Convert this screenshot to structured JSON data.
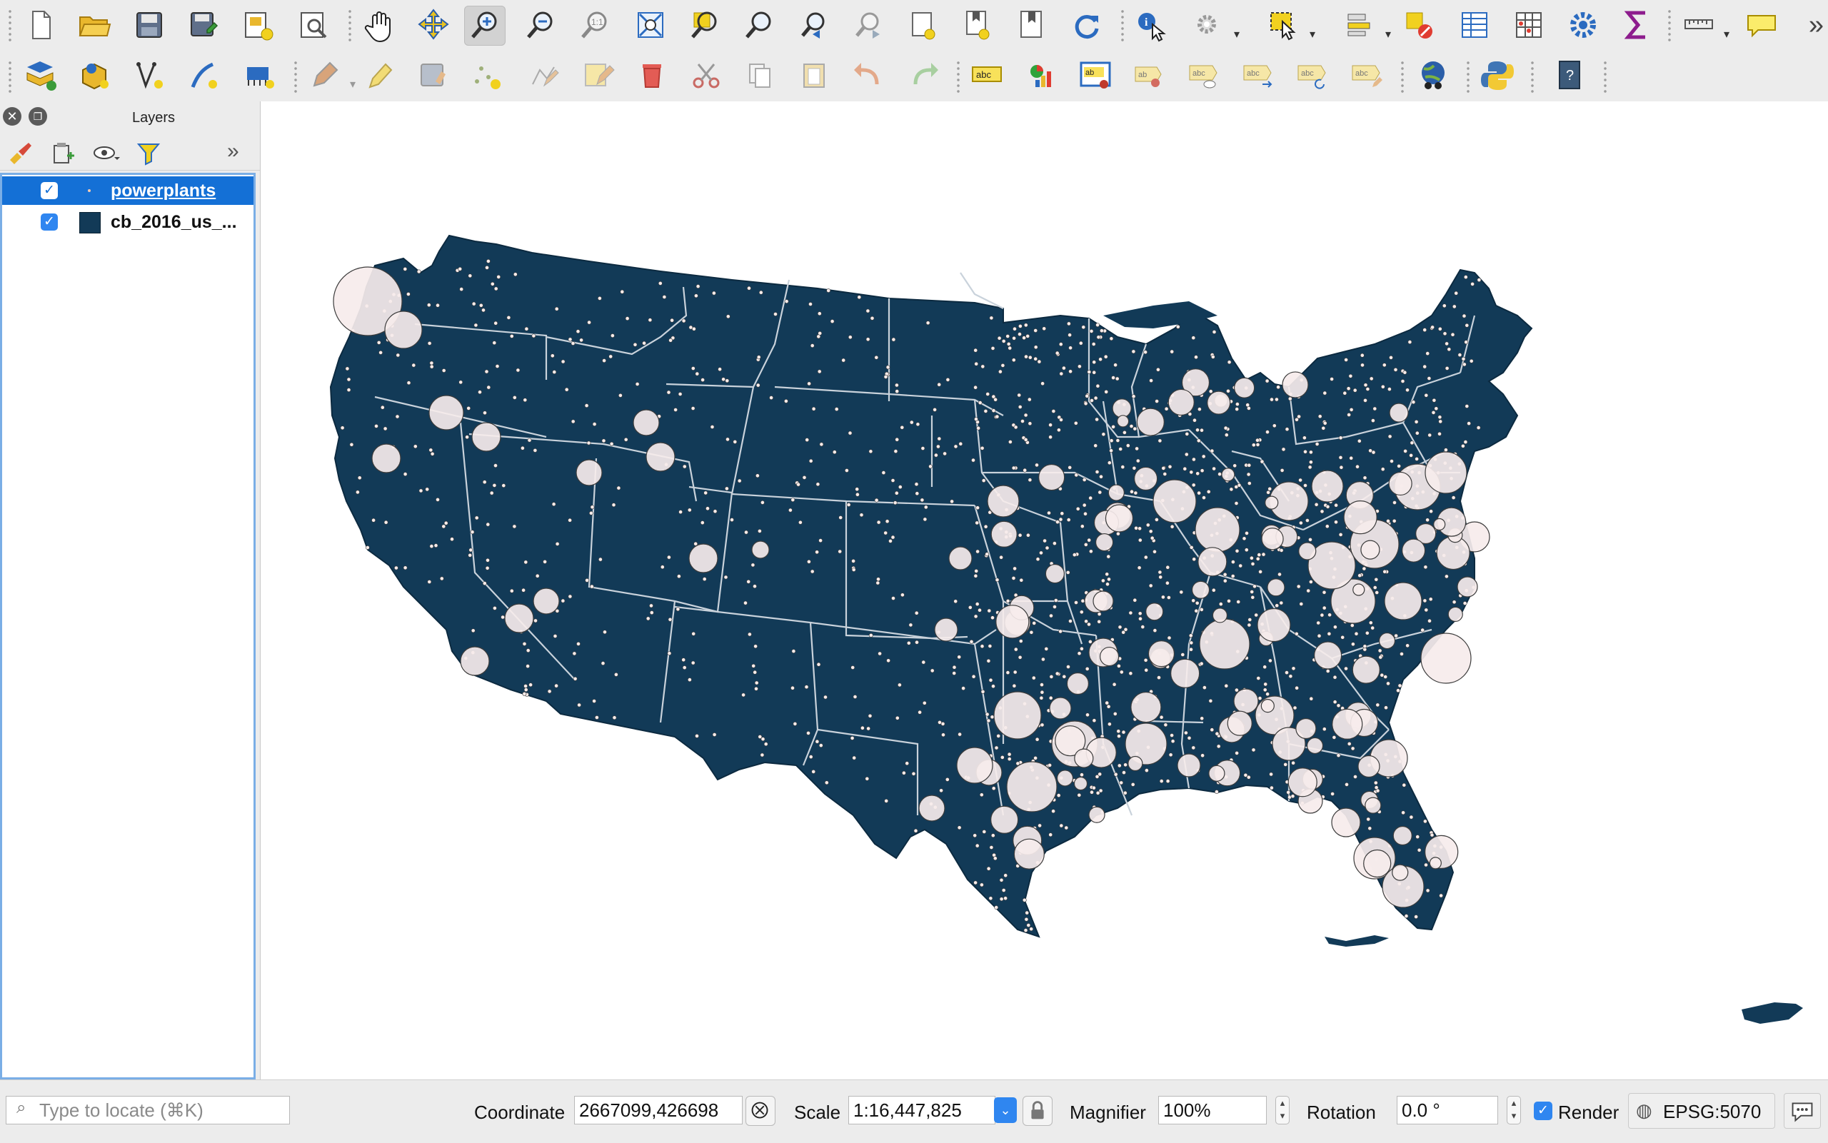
{
  "toolbar1": {
    "tools": [
      {
        "name": "new-project-icon"
      },
      {
        "name": "open-project-icon"
      },
      {
        "name": "save-project-icon"
      },
      {
        "name": "save-as-icon"
      },
      {
        "name": "new-print-layout-icon"
      },
      {
        "name": "layout-manager-icon"
      },
      {
        "name": "pan-icon"
      },
      {
        "name": "pan-to-selection-icon"
      },
      {
        "name": "zoom-in-icon",
        "active": true
      },
      {
        "name": "zoom-out-icon"
      },
      {
        "name": "zoom-native-icon"
      },
      {
        "name": "zoom-full-icon"
      },
      {
        "name": "zoom-to-selection-icon"
      },
      {
        "name": "zoom-to-layer-icon"
      },
      {
        "name": "zoom-last-icon"
      },
      {
        "name": "zoom-next-icon"
      },
      {
        "name": "new-bookmark-icon"
      },
      {
        "name": "show-bookmarks-icon"
      },
      {
        "name": "map-tips-icon"
      },
      {
        "name": "refresh-icon"
      },
      {
        "name": "identify-icon"
      },
      {
        "name": "action-icon"
      },
      {
        "name": "select-features-icon"
      },
      {
        "name": "attribute-table-icon"
      },
      {
        "name": "deselect-icon"
      },
      {
        "name": "open-table-icon"
      },
      {
        "name": "field-calculator-icon"
      },
      {
        "name": "processing-toolbox-icon"
      },
      {
        "name": "statistics-sigma-icon"
      },
      {
        "name": "measure-icon"
      },
      {
        "name": "annotation-icon"
      }
    ]
  },
  "toolbar2": {
    "tools": [
      {
        "name": "data-source-manager-icon"
      },
      {
        "name": "new-geopackage-icon"
      },
      {
        "name": "digitize-vertex-icon"
      },
      {
        "name": "new-gps-layer-icon"
      },
      {
        "name": "virtual-layer-icon"
      },
      {
        "name": "current-edits-icon"
      },
      {
        "name": "toggle-editing-icon"
      },
      {
        "name": "save-edits-icon"
      },
      {
        "name": "add-feature-icon"
      },
      {
        "name": "vertex-tool-icon"
      },
      {
        "name": "modify-attributes-icon"
      },
      {
        "name": "delete-selected-icon"
      },
      {
        "name": "cut-features-icon"
      },
      {
        "name": "copy-features-icon"
      },
      {
        "name": "paste-features-icon"
      },
      {
        "name": "undo-icon"
      },
      {
        "name": "redo-icon"
      },
      {
        "name": "label-abc-icon"
      },
      {
        "name": "diagram-icon"
      },
      {
        "name": "pin-labels-icon"
      },
      {
        "name": "highlight-pinned-icon"
      },
      {
        "name": "show-hide-labels-icon"
      },
      {
        "name": "move-label-icon"
      },
      {
        "name": "rotate-label-icon"
      },
      {
        "name": "change-label-icon"
      },
      {
        "name": "globe-plugin-icon"
      },
      {
        "name": "python-console-icon"
      },
      {
        "name": "help-icon"
      }
    ]
  },
  "layers_panel": {
    "title": "Layers",
    "layers": [
      {
        "name": "powerplants",
        "checked": true,
        "selected": true
      },
      {
        "name": "cb_2016_us_...",
        "checked": true,
        "selected": false,
        "swatch": "#123a57"
      }
    ]
  },
  "map": {
    "land_color": "#123a57",
    "border_color": "#c9d2db",
    "symbol_fill": "#f6eceb",
    "symbol_stroke": "#3b3b3b"
  },
  "statusbar": {
    "locator_placeholder": "Type to locate (⌘K)",
    "coordinate_label": "Coordinate",
    "coordinate_value": "2667099,426698",
    "scale_label": "Scale",
    "scale_value": "1:16,447,825",
    "magnifier_label": "Magnifier",
    "magnifier_value": "100%",
    "rotation_label": "Rotation",
    "rotation_value": "0.0 °",
    "render_label": "Render",
    "render_checked": true,
    "crs_value": "EPSG:5070"
  }
}
